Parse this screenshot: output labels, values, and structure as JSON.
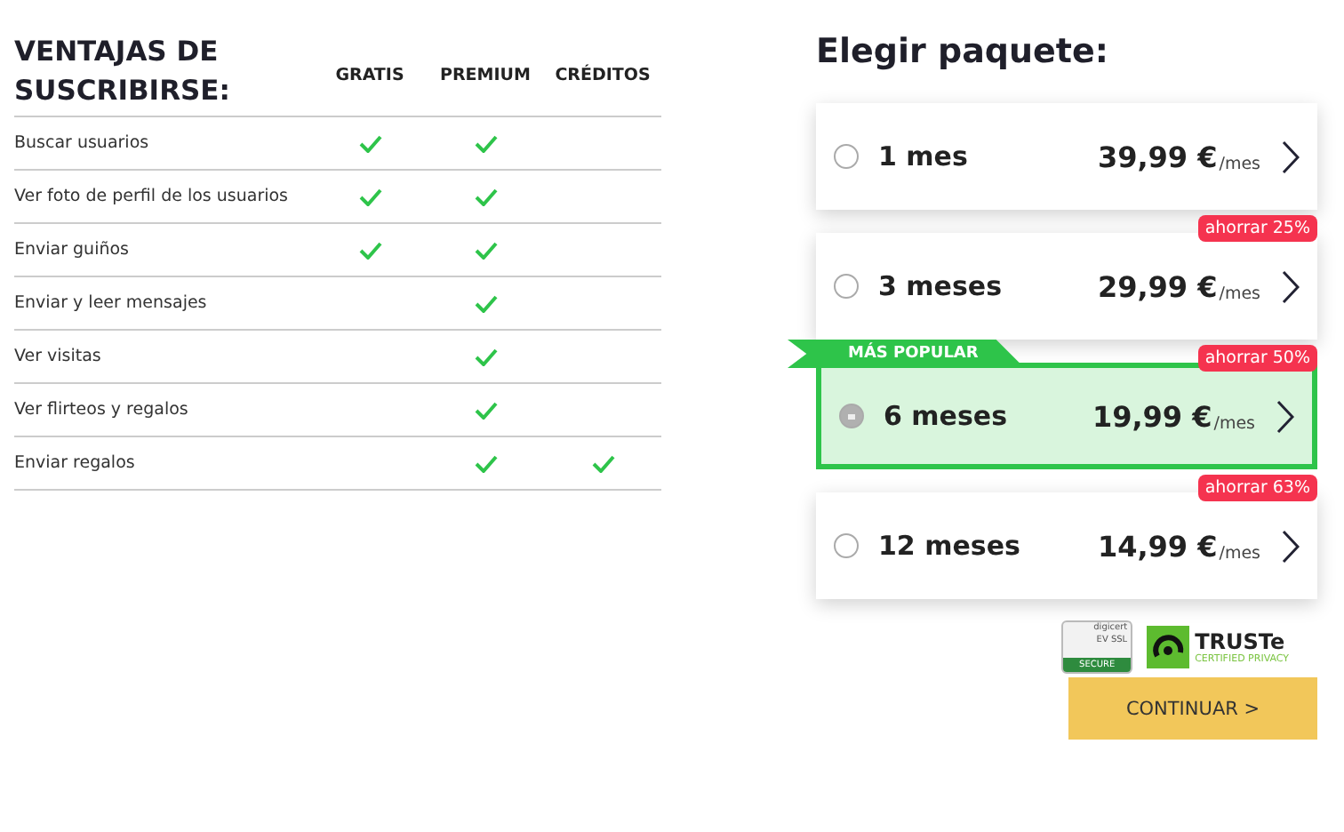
{
  "benefits": {
    "title": "VENTAJAS DE SUSCRIBIRSE:",
    "columns": [
      "GRATIS",
      "PREMIUM",
      "CRÉDITOS"
    ],
    "rows": [
      {
        "label": "Buscar usuarios",
        "checks": [
          true,
          true,
          false
        ]
      },
      {
        "label": "Ver foto de perfil de los usuarios",
        "checks": [
          true,
          true,
          false
        ]
      },
      {
        "label": "Enviar guiños",
        "checks": [
          true,
          true,
          false
        ]
      },
      {
        "label": "Enviar y leer mensajes",
        "checks": [
          false,
          true,
          false
        ]
      },
      {
        "label": "Ver visitas",
        "checks": [
          false,
          true,
          false
        ]
      },
      {
        "label": "Ver flirteos y regalos",
        "checks": [
          false,
          true,
          false
        ]
      },
      {
        "label": "Enviar regalos",
        "checks": [
          false,
          true,
          true
        ]
      }
    ]
  },
  "packages": {
    "title": "Elegir paquete:",
    "options": [
      {
        "name": "1 mes",
        "price": "39,99 €",
        "unit": "/mes",
        "selected": false
      },
      {
        "name": "3 meses",
        "price": "29,99 €",
        "unit": "/mes",
        "badge": "ahorrar 25%",
        "selected": false
      },
      {
        "name": "6 meses",
        "price": "19,99 €",
        "unit": "/mes",
        "badge": "ahorrar 50%",
        "ribbon": "MÁS POPULAR",
        "selected": true
      },
      {
        "name": "12 meses",
        "price": "14,99 €",
        "unit": "/mes",
        "badge": "ahorrar 63%",
        "selected": false
      }
    ]
  },
  "seals": {
    "digicert": {
      "brand": "digicert",
      "line": "EV SSL",
      "footer": "SECURE"
    },
    "truste": {
      "brand": "TRUSTe",
      "tagline": "CERTIFIED PRIVACY"
    }
  },
  "continue_button": "CONTINUAR >"
}
